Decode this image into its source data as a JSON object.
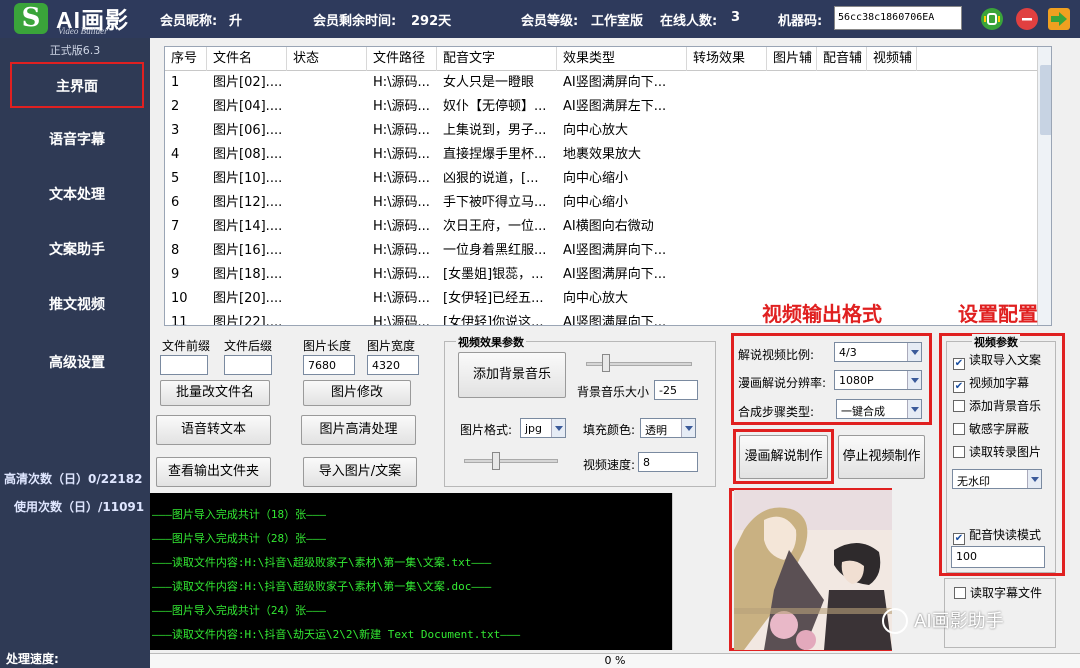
{
  "app": {
    "logo_glyph": "S",
    "title": "AI画影",
    "subtitle": "Video Builder",
    "version": "正式版6.3"
  },
  "topbar": {
    "nickname_label": "会员昵称:",
    "nickname": "升",
    "remaining_label": "会员剩余时间:",
    "remaining": "292天",
    "level_label": "会员等级:",
    "level": "工作室版",
    "online_label": "在线人数:",
    "online": "3",
    "machine_label": "机器码:",
    "machine_code": "56cc38c1860706EA",
    "icons": [
      "settings-icon",
      "close-icon",
      "exit-icon"
    ],
    "icon_colors": {
      "settings": "#3aa43a",
      "close": "#e04040",
      "exit": "#f0a020"
    }
  },
  "sidebar": {
    "items": [
      {
        "label": "主界面",
        "active": true
      },
      {
        "label": "语音字幕"
      },
      {
        "label": "文本处理"
      },
      {
        "label": "文案助手"
      },
      {
        "label": "推文视频"
      },
      {
        "label": "高级设置"
      }
    ],
    "hd_count": "高清次数（日）0/22182",
    "use_count": "使用次数（日）/11091",
    "speed_label": "处理速度:"
  },
  "table": {
    "columns": [
      "序号",
      "文件名",
      "状态",
      "文件路径",
      "配音文字",
      "效果类型",
      "转场效果",
      "图片辅",
      "配音辅",
      "视频辅"
    ],
    "rows": [
      [
        "1",
        "图片[02]....",
        "",
        "H:\\源码...",
        "女人只是一瞪眼",
        "AI竖图满屏向下..."
      ],
      [
        "2",
        "图片[04]....",
        "",
        "H:\\源码...",
        "奴仆【无停顿】...",
        "AI竖图满屏左下..."
      ],
      [
        "3",
        "图片[06]....",
        "",
        "H:\\源码...",
        "上集说到，男子...",
        "向中心放大"
      ],
      [
        "4",
        "图片[08]....",
        "",
        "H:\\源码...",
        "直接捏爆手里杯...",
        "地裹效果放大"
      ],
      [
        "5",
        "图片[10]....",
        "",
        "H:\\源码...",
        "凶狠的说道，[...",
        "向中心缩小"
      ],
      [
        "6",
        "图片[12]....",
        "",
        "H:\\源码...",
        "手下被吓得立马...",
        "向中心缩小"
      ],
      [
        "7",
        "图片[14]....",
        "",
        "H:\\源码...",
        "次日王府，一位...",
        "AI横图向右微动"
      ],
      [
        "8",
        "图片[16]....",
        "",
        "H:\\源码...",
        "一位身着黑红服...",
        "AI竖图满屏向下..."
      ],
      [
        "9",
        "图片[18]....",
        "",
        "H:\\源码...",
        "[女墨姐]银蕊，...",
        "AI竖图满屏向下..."
      ],
      [
        "10",
        "图片[20]....",
        "",
        "H:\\源码...",
        "[女伊轻]已经五...",
        "向中心放大"
      ],
      [
        "11",
        "图片[22]....",
        "",
        "H:\\源码...",
        "[女伊轻]你说这...",
        "AI竖图满屏向下..."
      ]
    ]
  },
  "controls": {
    "prefix_label": "文件前缀",
    "suffix_label": "文件后缀",
    "img_len_label": "图片长度",
    "img_wid_label": "图片宽度",
    "img_len": "7680",
    "img_wid": "4320",
    "batch_rename": "批量改文件名",
    "img_modify": "图片修改",
    "tts": "语音转文本",
    "img_hd": "图片高清处理",
    "view_output": "查看输出文件夹",
    "import_img": "导入图片/文案"
  },
  "video_effects": {
    "title": "视频效果参数",
    "add_bgm": "添加背景音乐",
    "bgm_volume_label": "背景音乐大小",
    "bgm_volume": "-25",
    "img_format_label": "图片格式:",
    "img_format": "jpg",
    "fill_color_label": "填充颜色:",
    "fill_color": "透明",
    "speed_label": "视频速度:",
    "speed": "8"
  },
  "output_format": {
    "heading": "视频输出格式",
    "ratio_label": "解说视频比例:",
    "ratio": "4/3",
    "resolution_label": "漫画解说分辨率:",
    "resolution": "1080P",
    "steps_label": "合成步骤类型:",
    "steps": "一键合成",
    "make": "漫画解说制作",
    "stop": "停止视频制作"
  },
  "settings": {
    "heading": "设置配置",
    "group_title": "视频参数",
    "checks": [
      {
        "label": "读取导入文案",
        "checked": true
      },
      {
        "label": "视频加字幕",
        "checked": true
      },
      {
        "label": "添加背景音乐",
        "checked": false
      },
      {
        "label": "敏感字屏蔽",
        "checked": false
      },
      {
        "label": "读取转录图片",
        "checked": false
      }
    ],
    "watermark": "无水印",
    "fast_read_label": "配音快读模式",
    "fast_read_checked": true,
    "fast_read_value": "100",
    "read_subtitle_label": "读取字幕文件"
  },
  "console": {
    "lines": [
      "———图片导入完成共计（18）张———",
      "———图片导入完成共计（28）张———",
      "———读取文件内容:H:\\抖音\\超级败家子\\素材\\第一集\\文案.txt———",
      "———读取文件内容:H:\\抖音\\超级败家子\\素材\\第一集\\文案.doc———",
      "———图片导入完成共计（24）张———",
      "———读取文件内容:H:\\抖音\\劫天运\\2\\2\\新建 Text Document.txt———"
    ]
  },
  "progress": {
    "value": "0 %"
  },
  "watermark_text": "AI画影助手"
}
